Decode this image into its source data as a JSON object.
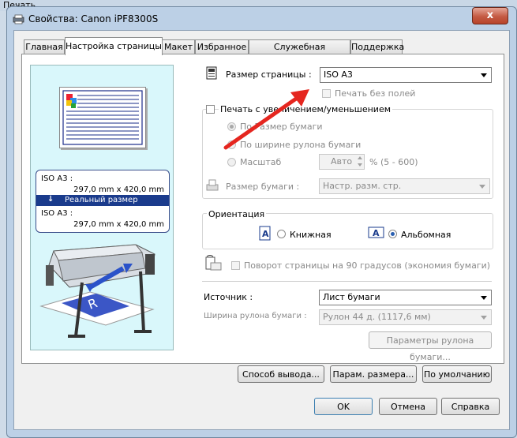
{
  "outer_title": "Печать",
  "window_title": "Свойства: Canon iPF8300S",
  "close_label": "x",
  "tabs": [
    {
      "label": "Главная"
    },
    {
      "label": "Настройка страницы"
    },
    {
      "label": "Макет"
    },
    {
      "label": "Избранное"
    },
    {
      "label": "Служебная программа"
    },
    {
      "label": "Поддержка"
    }
  ],
  "preview": {
    "size1_name": "ISO A3 :",
    "size1_dims": "297,0 mm x 420,0 mm",
    "real_size": "Реальный размер",
    "size2_name": "ISO A3 :",
    "size2_dims": "297,0 mm x 420,0 mm",
    "printer_letter": "R"
  },
  "page_size": {
    "label": "Размер страницы :",
    "value": "ISO A3"
  },
  "borderless": {
    "label": "Печать без полей",
    "checked": false
  },
  "scaling": {
    "label": "Печать с увеличением/уменьшением",
    "checked": false,
    "option_paper": "По Размер бумаги",
    "option_roll": "По ширине рулона бумаги",
    "option_scale": "Масштаб",
    "scale_value": "Авто",
    "scale_range": "% (5 - 600)",
    "paper_size_label": "Размер бумаги :",
    "paper_size_value": "Настр. разм. стр."
  },
  "orientation": {
    "label": "Ориентация",
    "portrait": "Книжная",
    "landscape": "Альбомная",
    "selected": "landscape"
  },
  "rotate": {
    "label": "Поворот страницы на 90 градусов (экономия бумаги)",
    "checked": false
  },
  "source": {
    "label": "Источник :",
    "value": "Лист бумаги"
  },
  "roll_width": {
    "label": "Ширина рулона бумаги :",
    "value": "Рулон 44 д. (1117,6 мм)"
  },
  "buttons": {
    "roll_params": "Параметры рулона бумаги...",
    "output_method": "Способ вывода...",
    "size_params": "Парам. размера...",
    "defaults": "По умолчанию",
    "ok": "OK",
    "cancel": "Отмена",
    "help": "Справка"
  },
  "colors": {
    "accent_arrow": "#e5261f",
    "selection": "#1a3b8c",
    "preview_bg": "#d9f7fb"
  }
}
